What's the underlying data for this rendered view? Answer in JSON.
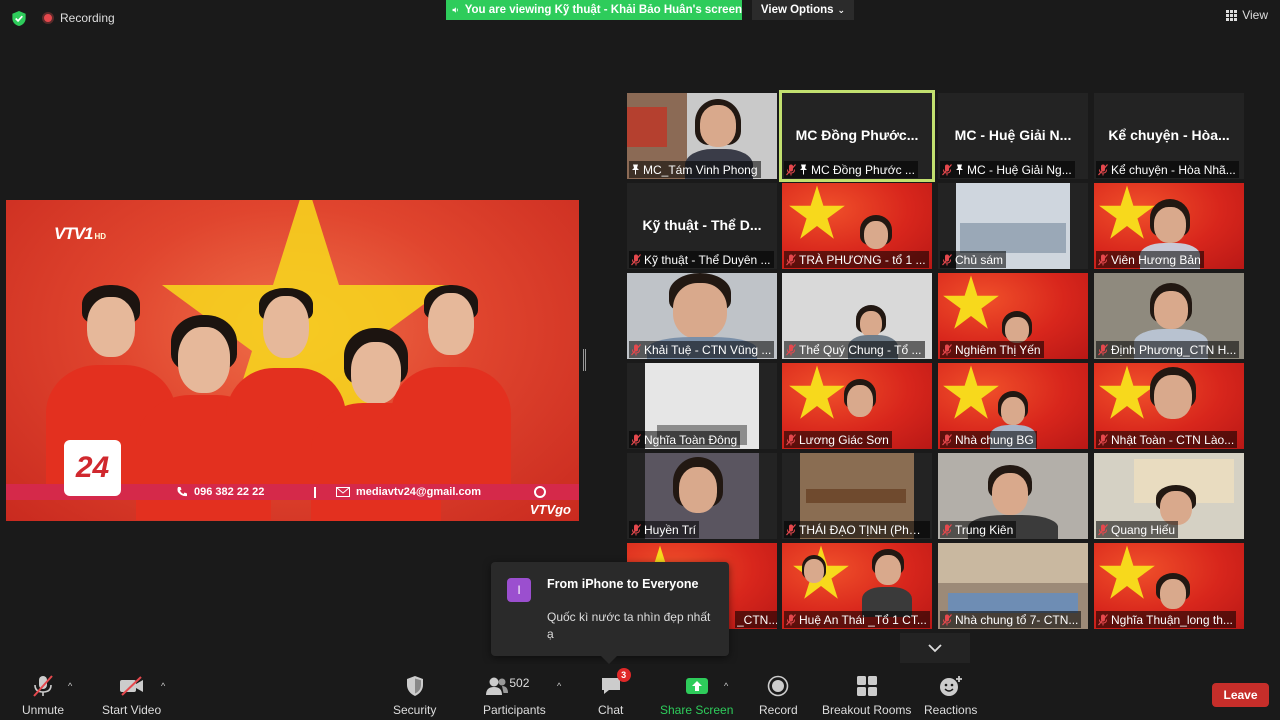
{
  "top": {
    "recording_label": "Recording",
    "viewing_banner": "You are viewing Kỹ thuật - Khải Bảo Huân's screen",
    "view_options_label": "View Options",
    "view_label": "View"
  },
  "shared_screen": {
    "channel_logo": "VTV1",
    "channel_hd": "HD",
    "logo_24": "24",
    "phone": "096 382 22 22",
    "email": "mediavtv24@gmail.com",
    "watermark": "VTVgo"
  },
  "gallery": {
    "tiles": [
      {
        "name": "MC_Tám Vinh Phong",
        "pinned": true
      },
      {
        "name": "MC Đồng Phước...",
        "display_name": "MC Đồng Phước...",
        "label": "MC Đồng Phước ...",
        "pinned": true,
        "active_speaker": true
      },
      {
        "name": "MC - Huệ Giải N...",
        "display_name": "MC - Huệ Giải N...",
        "label": "MC - Huệ Giải Ng...",
        "pinned": true
      },
      {
        "name": "Kể chuyện - Hòa...",
        "display_name": "Kể chuyện - Hòa...",
        "label": "Kể chuyện - Hòa Nhã..."
      },
      {
        "name": "Kỹ thuật - Thể D...",
        "display_name": "Kỹ thuật - Thể D...",
        "label": "Kỹ thuật - Thể Duyên ..."
      },
      {
        "label": "TRÀ PHƯƠNG - tổ 1 ..."
      },
      {
        "label": "Chủ sám"
      },
      {
        "label": "Viên Hương Bản"
      },
      {
        "label": "Khải Tuệ - CTN Vũng ..."
      },
      {
        "label": "Thể Quý Chung - Tổ ..."
      },
      {
        "label": "Nghiêm Thị Yến"
      },
      {
        "label": "Định Phương_CTN H..."
      },
      {
        "label": "Nghĩa Toàn Đông"
      },
      {
        "label": "Lương Giác Sơn"
      },
      {
        "label": "Nhà chung BG"
      },
      {
        "label": "Nhật Toàn - CTN Lào..."
      },
      {
        "label": "Huyền Trí"
      },
      {
        "label": "THÁI ĐẠO TỊNH (Phật..."
      },
      {
        "label": "Trung Kiên"
      },
      {
        "label": "Quang Hiếu"
      },
      {
        "label": "_CTN..."
      },
      {
        "label": "Huệ An Thái _Tổ 1 CT..."
      },
      {
        "label": "Nhà chung tổ 7- CTN..."
      },
      {
        "label": "Nghĩa Thuận_long th..."
      }
    ]
  },
  "chat_popup": {
    "avatar_letter": "I",
    "from": "From iPhone to Everyone",
    "message": "Quốc kì nước ta nhìn đẹp nhất ạ"
  },
  "toolbar": {
    "unmute": "Unmute",
    "start_video": "Start Video",
    "security": "Security",
    "participants": "Participants",
    "participants_count": "502",
    "chat": "Chat",
    "chat_badge": "3",
    "share_screen": "Share Screen",
    "record": "Record",
    "breakout_rooms": "Breakout Rooms",
    "reactions": "Reactions",
    "leave": "Leave"
  },
  "colors": {
    "share_green": "#2ecc5b",
    "active_speaker_border": "#c2e06f",
    "leave_red": "#c62e2a",
    "flag_red": "#d8261c",
    "flag_star": "#f7d91c"
  }
}
